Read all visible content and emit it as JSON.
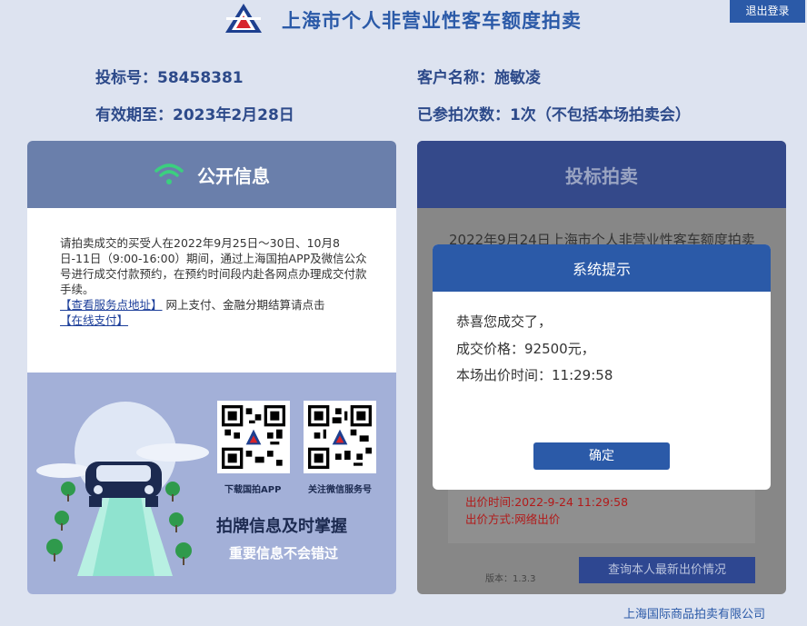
{
  "header": {
    "site_title": "上海市个人非营业性客车额度拍卖",
    "logout_label": "退出登录"
  },
  "account": {
    "bid_number": "投标号：58458381",
    "customer_name": "客户名称：施敏凌",
    "valid_until": "有效期至：2023年2月28日",
    "auction_count": "已参拍次数：1次（不包括本场拍卖会）"
  },
  "public_info": {
    "title": "公开信息",
    "notice_text": "请拍卖成交的买受人在2022年9月25日～30日、10月8日-11日（9:00-16:00）期间，通过上海国拍APP及微信公众号进行成交付款预约，在预约时间段内赴各网点办理成交付款手续。",
    "service_link": "【查看服务点地址】",
    "notice_text2": "网上支付、金融分期结算请点击",
    "pay_link": "【在线支付】",
    "qr1_caption": "下载国拍APP",
    "qr2_caption": "关注微信服务号",
    "promo_title": "拍牌信息及时掌握",
    "promo_subtitle": "重要信息不会错过"
  },
  "bidding": {
    "title": "投标拍卖",
    "auction_title": "2022年9月24日上海市个人非营业性客车额度拍卖",
    "bid_time": "出价时间:2022-9-24 11:29:58",
    "bid_method": "出价方式:网络出价",
    "version": "版本：1.3.3",
    "query_button": "查询本人最新出价情况"
  },
  "dialog": {
    "title": "系统提示",
    "line1": "恭喜您成交了，",
    "line2": "成交价格：92500元，",
    "line3": "本场出价时间：11:29:58",
    "ok_label": "确定"
  },
  "footer": {
    "company": "上海国际商品拍卖有限公司"
  },
  "colors": {
    "brand_blue": "#2b5aa8",
    "page_bg": "#dde3f0",
    "wifi_green": "#3bcf7f",
    "alert_red": "#b21a1a"
  }
}
